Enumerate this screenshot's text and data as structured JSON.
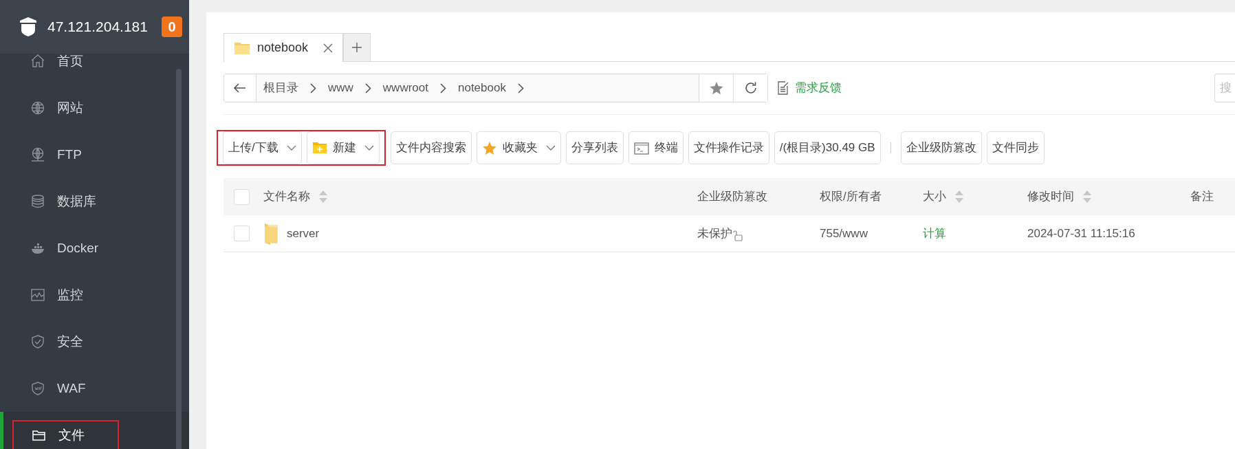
{
  "server": {
    "address": "47.121.204.181",
    "badge": "0"
  },
  "sidebar": {
    "items": [
      {
        "label": "首页",
        "selected": false,
        "highlighted": false
      },
      {
        "label": "网站",
        "selected": false,
        "highlighted": false
      },
      {
        "label": "FTP",
        "selected": false,
        "highlighted": false
      },
      {
        "label": "数据库",
        "selected": false,
        "highlighted": false
      },
      {
        "label": "Docker",
        "selected": false,
        "highlighted": false
      },
      {
        "label": "监控",
        "selected": false,
        "highlighted": false
      },
      {
        "label": "安全",
        "selected": false,
        "highlighted": false
      },
      {
        "label": "WAF",
        "selected": false,
        "highlighted": false
      },
      {
        "label": "文件",
        "selected": true,
        "highlighted": true
      }
    ]
  },
  "tabs": [
    {
      "label": "notebook",
      "selected": true
    }
  ],
  "breadcrumb": [
    "根目录",
    "www",
    "wwwroot",
    "notebook"
  ],
  "feedback_link": "需求反馈",
  "search": {
    "placeholder": "搜"
  },
  "toolbar_groups": [
    [
      {
        "label": "上传/下载",
        "kind": "dropdown",
        "highlighted": true
      },
      {
        "label": "新建",
        "kind": "dropdown",
        "highlighted": true
      },
      {
        "label": "文件内容搜索",
        "kind": "plain",
        "highlighted": false
      },
      {
        "label": "收藏夹",
        "kind": "dropdown",
        "highlighted": false
      },
      {
        "label": "分享列表",
        "kind": "plain",
        "highlighted": false
      },
      {
        "label": "终端",
        "kind": "plain",
        "highlighted": false
      },
      {
        "label": "文件操作记录",
        "kind": "plain",
        "highlighted": false
      },
      {
        "label": "/(根目录)30.49 GB",
        "kind": "plain",
        "highlighted": false
      }
    ],
    [
      {
        "label": "企业级防篡改",
        "kind": "plain",
        "highlighted": false
      },
      {
        "label": "文件同步",
        "kind": "plain",
        "highlighted": false
      }
    ]
  ],
  "table": {
    "all_checked": false,
    "columns": [
      {
        "label": "文件名称",
        "sortable": true
      },
      {
        "label": "企业级防篡改",
        "sortable": false
      },
      {
        "label": "权限/所有者",
        "sortable": false
      },
      {
        "label": "大小",
        "sortable": true
      },
      {
        "label": "修改时间",
        "sortable": true
      },
      {
        "label": "备注",
        "sortable": false
      }
    ],
    "rows": [
      {
        "checked": false,
        "name": "server",
        "protection": "未保护",
        "permission": "755/www",
        "size": "计算",
        "modified": "2024-07-31 11:15:16"
      }
    ]
  }
}
